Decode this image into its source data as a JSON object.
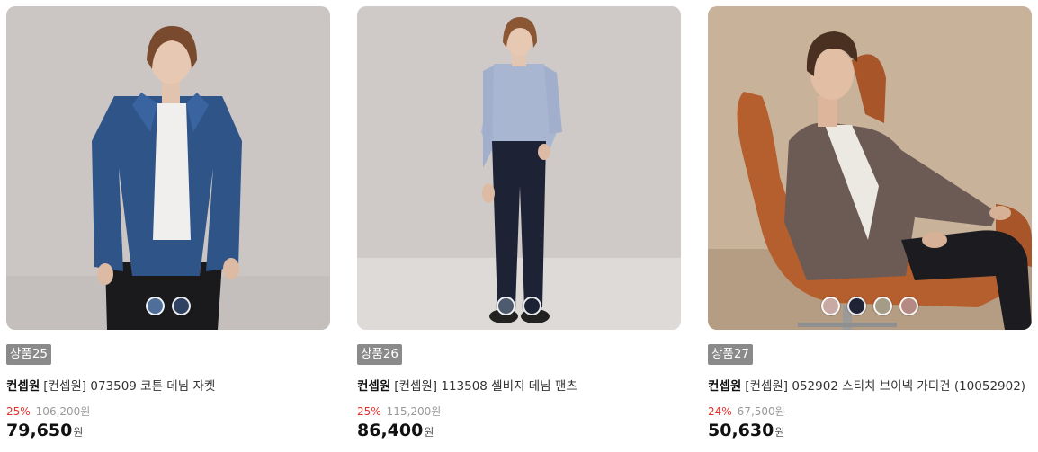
{
  "products": [
    {
      "badge": "상품25",
      "brand": "컨셉원",
      "name": "[컨셉원] 073509 코튼 데님 자켓",
      "discount": "25%",
      "original_price": "106,200원",
      "price": "79,650",
      "currency": "원",
      "swatch_colors": [
        "#4f6f9a",
        "#2f4262"
      ]
    },
    {
      "badge": "상품26",
      "brand": "컨셉원",
      "name": "[컨셉원] 113508 셀비지 데님 팬츠",
      "discount": "25%",
      "original_price": "115,200원",
      "price": "86,400",
      "currency": "원",
      "swatch_colors": [
        "#4e5a6e",
        "#1b2233"
      ]
    },
    {
      "badge": "상품27",
      "brand": "컨셉원",
      "name": "[컨셉원] 052902 스티치 브이넥 가디건 (10052902)",
      "discount": "24%",
      "original_price": "67,500원",
      "price": "50,630",
      "currency": "원",
      "swatch_colors": [
        "#c9a9a4",
        "#1e2335",
        "#a59c88",
        "#b58a82"
      ]
    }
  ]
}
